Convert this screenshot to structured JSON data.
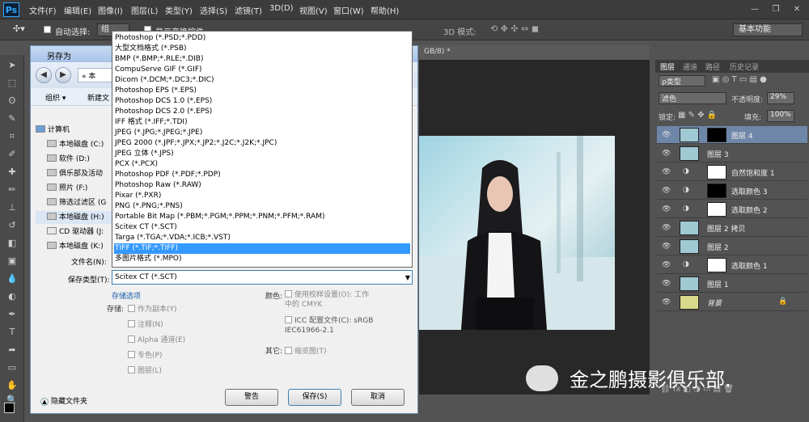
{
  "app": {
    "logo": "Ps"
  },
  "menu": [
    "文件(F)",
    "编辑(E)",
    "图像(I)",
    "图层(L)",
    "类型(Y)",
    "选择(S)",
    "滤镜(T)",
    "3D(D)",
    "视图(V)",
    "窗口(W)",
    "帮助(H)"
  ],
  "window_controls": [
    "—",
    "❐",
    "✕"
  ],
  "options": {
    "auto_select_label": "自动选择:",
    "auto_select_value": "组",
    "show_transform": "显示变换控件",
    "mode_3d": "3D 模式:",
    "workspace": "基本功能"
  },
  "document": {
    "tab": "GB/8) *"
  },
  "layers_panel": {
    "tabs": [
      "图层",
      "通道",
      "路径",
      "历史记录"
    ],
    "kind_filter": "ρ类型",
    "blend_mode": "滤色",
    "opacity_label": "不透明度:",
    "opacity": "29%",
    "lock_label": "锁定:",
    "fill_label": "填充:",
    "fill": "100%",
    "layers": [
      {
        "name": "图层 4"
      },
      {
        "name": "图层 3"
      },
      {
        "name": "自然饱和度 1"
      },
      {
        "name": "选取颜色 3"
      },
      {
        "name": "选取颜色 2"
      },
      {
        "name": "图层 2 拷贝"
      },
      {
        "name": "图层 2"
      },
      {
        "name": "选取颜色 1"
      },
      {
        "name": "图层 1"
      },
      {
        "name": "背景"
      }
    ]
  },
  "dialog": {
    "title": "另存为",
    "path_partial": "« 本",
    "organize": "组织 ▾",
    "new_folder": "新建文",
    "tree": [
      "计算机",
      "本地磁盘 (C:)",
      "软件 (D:)",
      "俱乐部及活动",
      "照片 (F:)",
      "筛选过滤区 (G",
      "本地磁盘 (H:)",
      "CD 驱动器 (J:",
      "本地磁盘 (K:)"
    ],
    "filename_label": "文件名(N):",
    "savetype_label": "保存类型(T):",
    "savetype_value": "Scitex CT (*.SCT)",
    "save_options_title": "存储选项",
    "save_label": "存储:",
    "as_copy": "作为副本(Y)",
    "notes": "注释(N)",
    "alpha": "Alpha 通道(E)",
    "spot": "专色(P)",
    "layers": "图层(L)",
    "color_label": "颜色:",
    "use_proof": "使用校样设置(O): 工作中的 CMYK",
    "icc": "ICC 配置文件(C): sRGB IEC61966-2.1",
    "other_label": "其它:",
    "thumbnail": "缩览图(T)",
    "hide_folders": "隐藏文件夹",
    "warning_btn": "警告",
    "save_btn": "保存(S)",
    "cancel_btn": "取消"
  },
  "format_options": [
    "Photoshop (*.PSD;*.PDD)",
    "大型文档格式 (*.PSB)",
    "BMP (*.BMP;*.RLE;*.DIB)",
    "CompuServe GIF (*.GIF)",
    "Dicom (*.DCM;*.DC3;*.DIC)",
    "Photoshop EPS (*.EPS)",
    "Photoshop DCS 1.0 (*.EPS)",
    "Photoshop DCS 2.0 (*.EPS)",
    "IFF 格式 (*.IFF;*.TDI)",
    "JPEG (*.JPG;*.JPEG;*.JPE)",
    "JPEG 2000 (*.JPF;*.JPX;*.JP2;*.J2C;*.J2K;*.JPC)",
    "JPEG 立体 (*.JPS)",
    "PCX (*.PCX)",
    "Photoshop PDF (*.PDF;*.PDP)",
    "Photoshop Raw (*.RAW)",
    "Pixar (*.PXR)",
    "PNG (*.PNG;*.PNS)",
    "Portable Bit Map (*.PBM;*.PGM;*.PPM;*.PNM;*.PFM;*.RAM)",
    "Scitex CT (*.SCT)",
    "Targa (*.TGA;*.VDA;*.ICB;*.VST)",
    "TIFF (*.TIF;*.TIFF)",
    "多图片格式 (*.MPO)"
  ],
  "selected_format": "TIFF (*.TIF;*.TIFF)",
  "watermark": "金之鹏摄影俱乐部."
}
